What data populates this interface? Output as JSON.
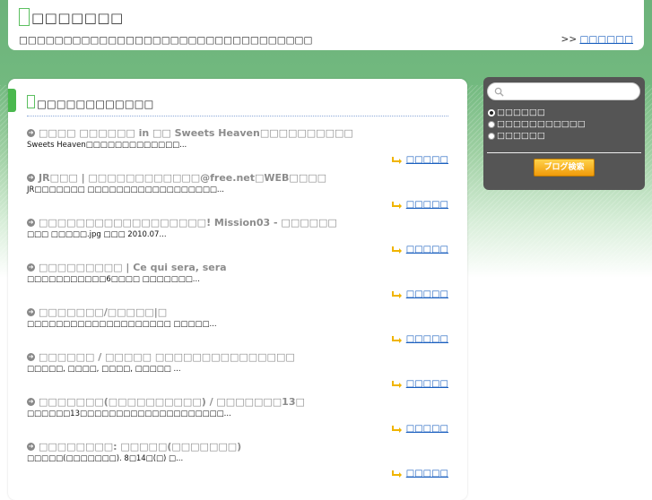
{
  "header": {
    "site_title": "□□□□□□□",
    "site_description": "□□□□□□□□□□□□□□□□□□□□□□□□□□□□□□□□□",
    "link_prefix": ">>",
    "link_label": "□□□□□□"
  },
  "main": {
    "section_title": "□□□□□□□□□□□□",
    "more_label": "□□□□□",
    "entries": [
      {
        "title": "□□□□ □□□□□□ in □□ Sweets Heaven□□□□□□□□□□",
        "excerpt": "Sweets Heaven□□□□□□□□□□□□□..."
      },
      {
        "title": "JR□□□ | □□□□□□□□□□□□@free.net□WEB□□□□",
        "excerpt": "JR□□□□□□□ □□□□□□□□□□□□□□□□□□..."
      },
      {
        "title": "□□□□□□□□□□□□□□□□□□! Mission03 - □□□□□□",
        "excerpt": "□□□ □□□□□.jpg □□□ 2010.07..."
      },
      {
        "title": "□□□□□□□□□ | Ce qui sera, sera",
        "excerpt": "□□□□□□□□□□□6□□□□ □□□□□□□..."
      },
      {
        "title": "□□□□□□□/□□□□□|□",
        "excerpt": "□□□□□□□□□□□□□□□□□□□□ □□□□□..."
      },
      {
        "title": "□□□□□□ / □□□□□ □□□□□□□□□□□□□□□",
        "excerpt": "□□□□□, □□□□, □□□□, □□□□□ ..."
      },
      {
        "title": "□□□□□□□(□□□□□□□□□□) / □□□□□□□13□",
        "excerpt": "□□□□□□13□□□□□□□□□□□□□□□□□□□□..."
      },
      {
        "title": "□□□□□□□□: □□□□□(□□□□□□□)",
        "excerpt": "□□□□□(□□□□□□□). 8□14□(□) □..."
      }
    ]
  },
  "sidebar": {
    "search_placeholder": "",
    "options": [
      {
        "label": "□□□□□□",
        "selected": true
      },
      {
        "label": "□□□□□□□□□□□",
        "selected": false
      },
      {
        "label": "□□□□□□",
        "selected": false
      }
    ],
    "search_button_label": "ブログ検索"
  },
  "colors": {
    "accent_green": "#4ab84e",
    "link_blue": "#1a5fbf",
    "sidebar_bg": "#555555",
    "button_orange": "#f5b21f"
  }
}
